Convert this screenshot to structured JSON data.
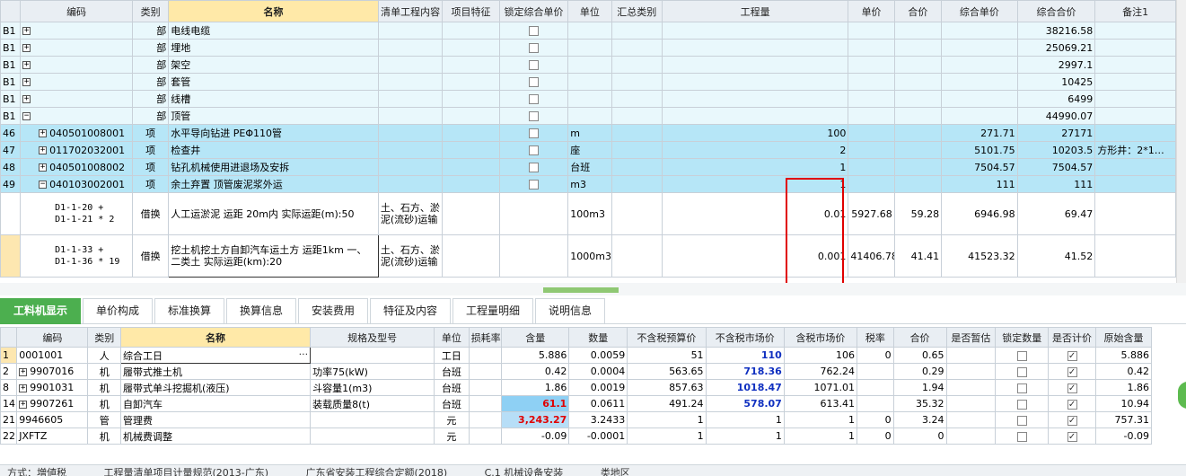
{
  "top_headers": [
    "编码",
    "类别",
    "名称",
    "清单工程内容",
    "项目特征",
    "锁定综合单价",
    "单位",
    "汇总类别",
    "工程量",
    "单价",
    "合价",
    "综合单价",
    "综合合价",
    "备注1"
  ],
  "top_rows": [
    {
      "kind": "part",
      "code": "B1",
      "sign": "+",
      "type": "部",
      "name": "电线电缆",
      "total": "38216.58"
    },
    {
      "kind": "part",
      "code": "B1",
      "sign": "+",
      "type": "部",
      "name": "埋地",
      "total": "25069.21"
    },
    {
      "kind": "part",
      "code": "B1",
      "sign": "+",
      "type": "部",
      "name": "架空",
      "total": "2997.1"
    },
    {
      "kind": "part",
      "code": "B1",
      "sign": "+",
      "type": "部",
      "name": "套管",
      "total": "10425"
    },
    {
      "kind": "part",
      "code": "B1",
      "sign": "+",
      "type": "部",
      "name": "线槽",
      "total": "6499"
    },
    {
      "kind": "part",
      "code": "B1",
      "sign": "−",
      "type": "部",
      "name": "顶管",
      "total": "44990.07"
    }
  ],
  "item_rows": [
    {
      "no": "46",
      "sign": "+",
      "code": "040501008001",
      "type": "项",
      "name": "水平导向钻进 PEΦ110管",
      "unit": "m",
      "qty": "100",
      "cunit": "271.71",
      "ctotal": "27171",
      "note": ""
    },
    {
      "no": "47",
      "sign": "+",
      "code": "011702032001",
      "type": "项",
      "name": "检查井",
      "unit": "座",
      "qty": "2",
      "cunit": "5101.75",
      "ctotal": "10203.5",
      "note": "方形井：2*1…"
    },
    {
      "no": "48",
      "sign": "+",
      "code": "040501008002",
      "type": "项",
      "name": "钻孔机械使用进退场及安拆",
      "unit": "台班",
      "qty": "1",
      "cunit": "7504.57",
      "ctotal": "7504.57",
      "note": ""
    },
    {
      "no": "49",
      "sign": "−",
      "code": "040103002001",
      "type": "项",
      "name": "余土弃置 顶管废泥浆外运",
      "unit": "m3",
      "qty": "1",
      "cunit": "111",
      "ctotal": "111",
      "note": ""
    }
  ],
  "sub_rows": [
    {
      "code1": "D1-1-20 +",
      "code2": "D1-1-21 * 2",
      "type": "借换",
      "name": "人工运淤泥 运距 20m内  实际运距(m):50",
      "content": "土、石方、淤泥(流砂)运输",
      "unit": "100m3",
      "qty": "0.01",
      "price": "5927.68",
      "total": "59.28",
      "cunit": "6946.98",
      "ctotal": "69.47"
    },
    {
      "code1": "D1-1-33 +",
      "code2": "D1-1-36 * 19",
      "type": "借换",
      "name": "挖土机挖土方自卸汽车运土方 运距1km 一、二类土  实际运距(km):20",
      "content": "土、石方、淤泥(流砂)运输",
      "unit": "1000m3",
      "qty": "0.001",
      "price": "41406.78",
      "total": "41.41",
      "cunit": "41523.32",
      "ctotal": "41.52"
    }
  ],
  "tabs": [
    "工料机显示",
    "单价构成",
    "标准换算",
    "换算信息",
    "安装费用",
    "特征及内容",
    "工程量明细",
    "说明信息"
  ],
  "bottom_headers": [
    "编码",
    "类别",
    "名称",
    "规格及型号",
    "单位",
    "损耗率",
    "含量",
    "数量",
    "不含税预算价",
    "不含税市场价",
    "含税市场价",
    "税率",
    "合价",
    "是否暂估",
    "锁定数量",
    "是否计价",
    "原始含量"
  ],
  "bottom_rows": [
    {
      "no": "1",
      "sign": "",
      "code": "0001001",
      "type": "人",
      "name": "综合工日",
      "spec": "",
      "unit": "工日",
      "loss": "",
      "content": "5.886",
      "qty": "0.0059",
      "budget": "51",
      "market": "110",
      "taxmarket": "106",
      "tax": "0",
      "total": "0.65",
      "counted": true,
      "orig": "5.886"
    },
    {
      "no": "2",
      "sign": "+",
      "code": "9907016",
      "type": "机",
      "name": "履带式推土机",
      "spec": "功率75(kW)",
      "unit": "台班",
      "loss": "",
      "content": "0.42",
      "qty": "0.0004",
      "budget": "563.65",
      "market": "718.36",
      "taxmarket": "762.24",
      "tax": "",
      "total": "0.29",
      "counted": true,
      "orig": "0.42"
    },
    {
      "no": "8",
      "sign": "+",
      "code": "9901031",
      "type": "机",
      "name": "履带式单斗挖掘机(液压)",
      "spec": "斗容量1(m3)",
      "unit": "台班",
      "loss": "",
      "content": "1.86",
      "qty": "0.0019",
      "budget": "857.63",
      "market": "1018.47",
      "taxmarket": "1071.01",
      "tax": "",
      "total": "1.94",
      "counted": true,
      "orig": "1.86"
    },
    {
      "no": "14",
      "sign": "+",
      "code": "9907261",
      "type": "机",
      "name": "自卸汽车",
      "spec": "装载质量8(t)",
      "unit": "台班",
      "loss": "",
      "content": "61.1",
      "qty": "0.0611",
      "budget": "491.24",
      "market": "578.07",
      "taxmarket": "613.41",
      "tax": "",
      "total": "35.32",
      "counted": true,
      "orig": "10.94"
    },
    {
      "no": "21",
      "sign": "",
      "code": "9946605",
      "type": "管",
      "name": "管理费",
      "spec": "",
      "unit": "元",
      "loss": "",
      "content": "3,243.27",
      "qty": "3.2433",
      "budget": "1",
      "market": "1",
      "taxmarket": "1",
      "tax": "0",
      "total": "3.24",
      "counted": true,
      "orig": "757.31"
    },
    {
      "no": "22",
      "sign": "",
      "code": "JXFTZ",
      "type": "机",
      "name": "机械费调整",
      "spec": "",
      "unit": "元",
      "loss": "",
      "content": "-0.09",
      "qty": "-0.0001",
      "budget": "1",
      "market": "1",
      "taxmarket": "1",
      "tax": "0",
      "total": "0",
      "counted": true,
      "orig": "-0.09"
    }
  ],
  "status_items": [
    "方式：増値税",
    "工程量清单项目计量规范(2013-广东)",
    "广东省安装工程综合定额(2018)",
    "C.1 机械设备安装",
    "类地区"
  ],
  "colors": {
    "accent_green": "#4caf4f",
    "header_bg": "#e9eef3",
    "item_row_bg": "#b6e6f7",
    "part_row_bg": "#e9f8fc",
    "highlight_header": "#ffe9a8",
    "annotation_red": "#e00000",
    "market_price_blue": "#1030c0"
  }
}
